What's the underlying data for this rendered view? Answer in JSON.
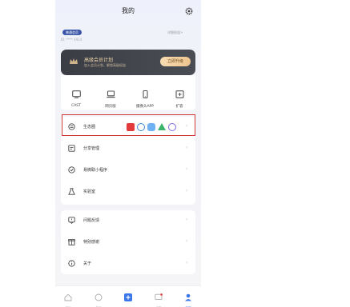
{
  "header": {
    "title": "我的",
    "settings_icon": "gear-icon"
  },
  "account": {
    "member_badge": "普通会员",
    "member_id": "ID: **** 4923",
    "detail_link": "详细权益>"
  },
  "banner": {
    "title": "高级会员计划",
    "subtitle": "加入会员计划，解锁高级权益",
    "button": "立即升级"
  },
  "quick_actions": [
    {
      "label": "CAST",
      "icon": "tv-icon"
    },
    {
      "label": "网页版",
      "icon": "laptop-icon"
    },
    {
      "label": "摄像头APP",
      "icon": "phone-icon"
    },
    {
      "label": "扩容",
      "icon": "expand-icon"
    }
  ],
  "menu_main": [
    {
      "label": "生态圈",
      "icon": "ecosystem-icon"
    },
    {
      "label": "分享管理",
      "icon": "share-icon"
    },
    {
      "label": "易微联小程序",
      "icon": "mini-program-icon"
    },
    {
      "label": "实验室",
      "icon": "flask-icon"
    }
  ],
  "menu_secondary": [
    {
      "label": "问题反馈",
      "icon": "feedback-icon"
    },
    {
      "label": "特别感谢",
      "icon": "gift-icon"
    },
    {
      "label": "关于",
      "icon": "info-icon"
    }
  ],
  "tabbar": [
    {
      "label": "首页",
      "icon": "home-icon"
    },
    {
      "label": "场景",
      "icon": "scene-icon"
    },
    {
      "label": "",
      "icon": "plus-icon"
    },
    {
      "label": "消息",
      "icon": "message-icon"
    },
    {
      "label": "我的",
      "icon": "profile-icon"
    }
  ],
  "colors": {
    "accent": "#3b76e8",
    "highlight_border": "#d23a3a",
    "banner_bg": "#3b3d45",
    "gold": "#eec48f"
  }
}
